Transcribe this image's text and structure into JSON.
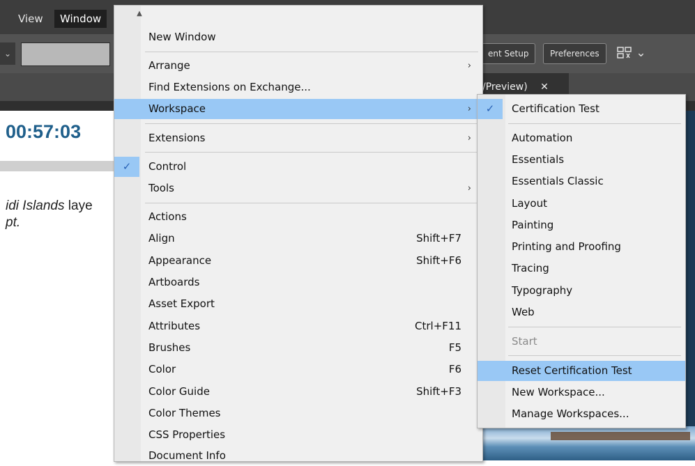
{
  "menubar": {
    "items": [
      {
        "label": "View"
      },
      {
        "label": "Window"
      }
    ]
  },
  "controlbar": {
    "document_setup_label": "ent Setup",
    "preferences_label": "Preferences",
    "arrange_icon": "arrange-documents-icon",
    "chevron": "⌄"
  },
  "tab": {
    "label": "/Preview)",
    "close": "✕"
  },
  "content": {
    "timer": "00:57:03",
    "text_italic": "idi Islands",
    "text_rest": " laye",
    "text_line2": "pt."
  },
  "window_menu": {
    "scroll_up": "▲",
    "items": {
      "new_window": {
        "label": "New Window"
      },
      "arrange": {
        "label": "Arrange",
        "arrow": "›"
      },
      "find_extensions": {
        "label": "Find Extensions on Exchange..."
      },
      "workspace": {
        "label": "Workspace",
        "arrow": "›"
      },
      "extensions": {
        "label": "Extensions",
        "arrow": "›"
      },
      "control": {
        "label": "Control",
        "check": "✓"
      },
      "tools": {
        "label": "Tools",
        "arrow": "›"
      },
      "actions": {
        "label": "Actions"
      },
      "align": {
        "label": "Align",
        "shortcut": "Shift+F7"
      },
      "appearance": {
        "label": "Appearance",
        "shortcut": "Shift+F6"
      },
      "artboards": {
        "label": "Artboards"
      },
      "asset_export": {
        "label": "Asset Export"
      },
      "attributes": {
        "label": "Attributes",
        "shortcut": "Ctrl+F11"
      },
      "brushes": {
        "label": "Brushes",
        "shortcut": "F5"
      },
      "color": {
        "label": "Color",
        "shortcut": "F6"
      },
      "color_guide": {
        "label": "Color Guide",
        "shortcut": "Shift+F3"
      },
      "color_themes": {
        "label": "Color Themes"
      },
      "css_properties": {
        "label": "CSS Properties"
      },
      "document_info": {
        "label": "Document Info"
      }
    }
  },
  "workspace_submenu": {
    "items": {
      "certification_test": {
        "label": "Certification Test",
        "check": "✓"
      },
      "automation": {
        "label": "Automation"
      },
      "essentials": {
        "label": "Essentials"
      },
      "essentials_classic": {
        "label": "Essentials Classic"
      },
      "layout": {
        "label": "Layout"
      },
      "painting": {
        "label": "Painting"
      },
      "printing_proofing": {
        "label": "Printing and Proofing"
      },
      "tracing": {
        "label": "Tracing"
      },
      "typography": {
        "label": "Typography"
      },
      "web": {
        "label": "Web"
      },
      "start": {
        "label": "Start"
      },
      "reset": {
        "label": "Reset Certification Test"
      },
      "new_workspace": {
        "label": "New Workspace..."
      },
      "manage_workspaces": {
        "label": "Manage Workspaces..."
      }
    }
  },
  "colors": {
    "highlight": "#99c8f5",
    "menu_bg": "#f0f0f0",
    "chrome_dark": "#3d3d3d",
    "timer_blue": "#1f5f8b",
    "check_blue": "#2962b6"
  }
}
